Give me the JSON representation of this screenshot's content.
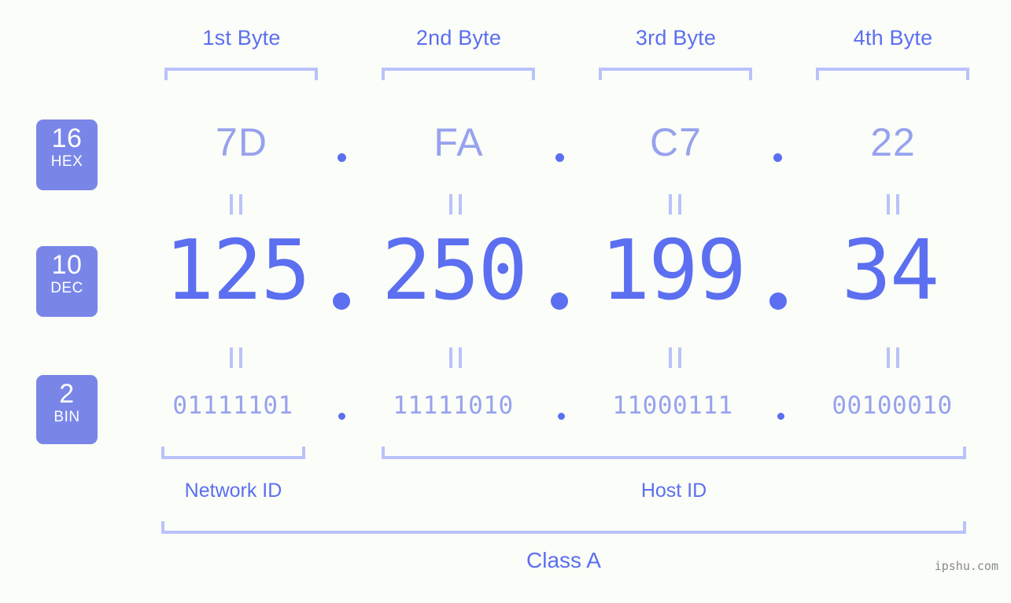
{
  "background_color": "#fbfdf8",
  "accent_color": "#5b6ff0",
  "light_accent_color": "#97a2ee",
  "bracket_color": "#b9c2fb",
  "badge_color": "#7986e8",
  "byte_headers": [
    {
      "label": "1st Byte"
    },
    {
      "label": "2nd Byte"
    },
    {
      "label": "3rd Byte"
    },
    {
      "label": "4th Byte"
    }
  ],
  "rows": {
    "hex": {
      "badge_number": "16",
      "badge_name": "HEX",
      "values": [
        "7D",
        "FA",
        "C7",
        "22"
      ]
    },
    "dec": {
      "badge_number": "10",
      "badge_name": "DEC",
      "values": [
        "125",
        "250",
        "199",
        "34"
      ]
    },
    "bin": {
      "badge_number": "2",
      "badge_name": "BIN",
      "values": [
        "01111101",
        "11111010",
        "11000111",
        "00100010"
      ]
    }
  },
  "separator": ".",
  "equals_symbol": "||",
  "segments": {
    "network_id_label": "Network ID",
    "host_id_label": "Host ID"
  },
  "class_label": "Class A",
  "watermark": "ipshu.com"
}
